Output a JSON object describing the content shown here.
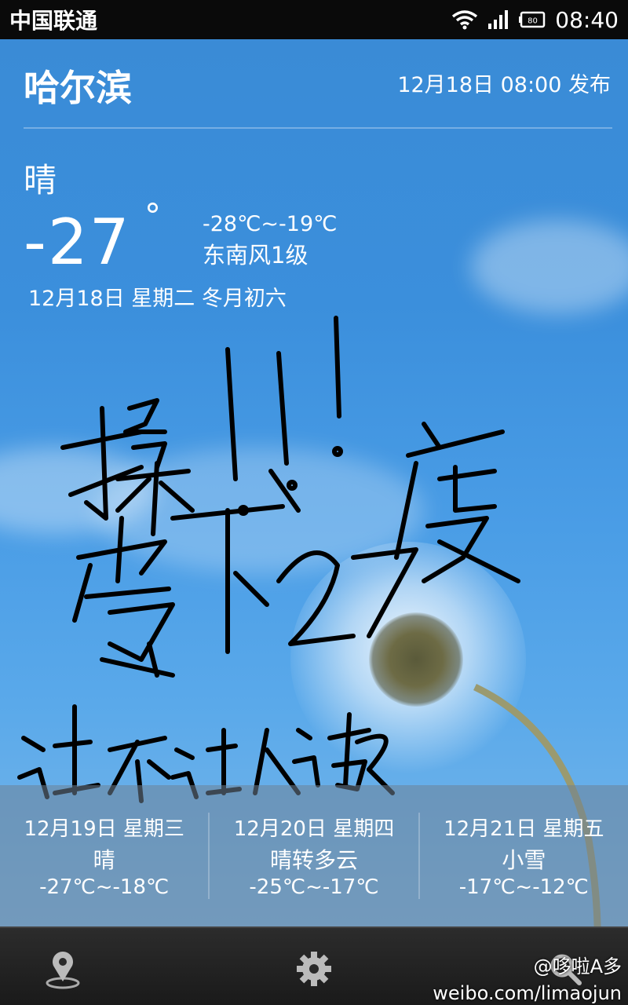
{
  "status_bar": {
    "carrier": "中国联通",
    "time": "08:40",
    "battery_level": "80"
  },
  "weather": {
    "city": "哈尔滨",
    "published": "12月18日 08:00 发布",
    "condition": "晴",
    "temperature": "-27",
    "degree_symbol": "°",
    "range": "-28℃~-19℃",
    "wind": "东南风1级",
    "date_full": "12月18日 星期二 冬月初六"
  },
  "handwriting": {
    "line1": "操!!!",
    "line2": "零下27度",
    "line3": "让不让人活了"
  },
  "forecast": [
    {
      "date": "12月19日 星期三",
      "condition": "晴",
      "range": "-27℃~-18℃"
    },
    {
      "date": "12月20日 星期四",
      "condition": "晴转多云",
      "range": "-25℃~-17℃"
    },
    {
      "date": "12月21日 星期五",
      "condition": "小雪",
      "range": "-17℃~-12℃"
    }
  ],
  "bottom_nav": {
    "icons": [
      "location-pin-icon",
      "gear-icon",
      "search-icon"
    ]
  },
  "watermark": {
    "line1": "@哆啦A多",
    "line2": "weibo.com/limaojun"
  }
}
